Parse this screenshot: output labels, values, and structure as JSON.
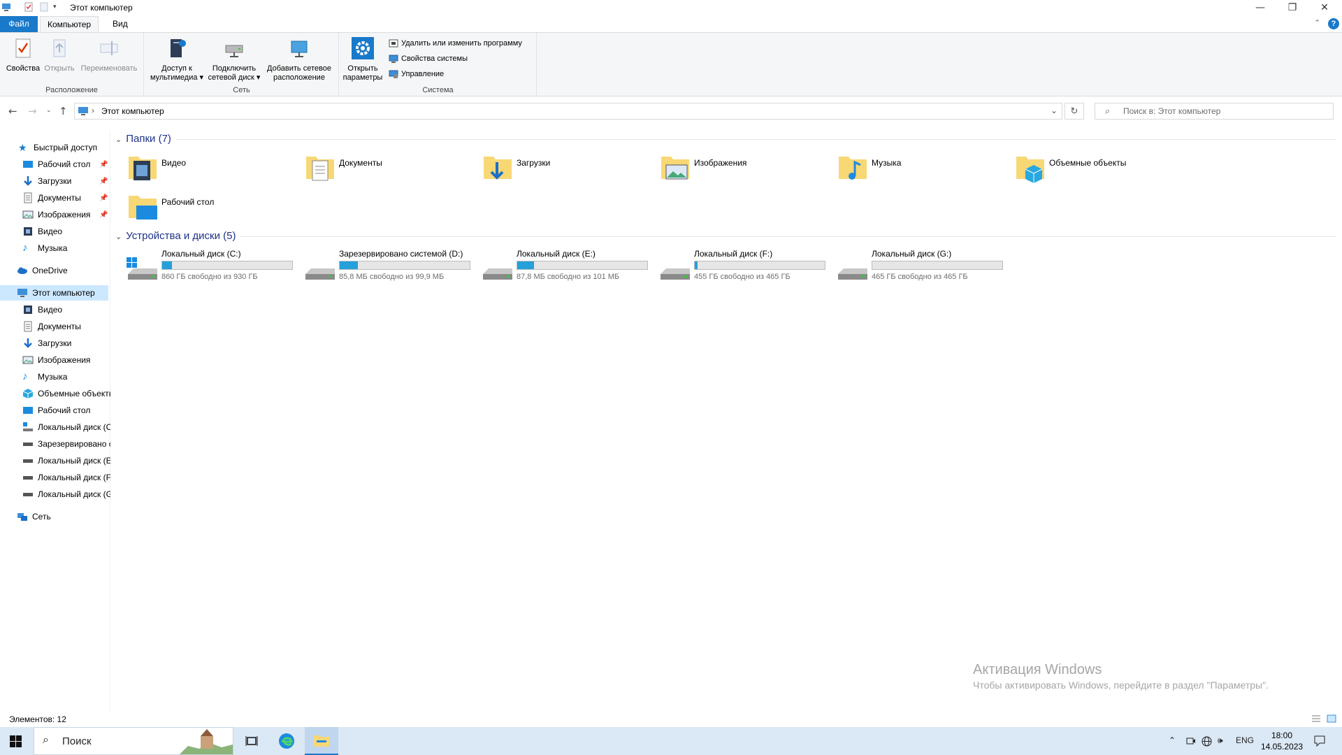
{
  "window": {
    "title": "Этот компьютер",
    "minimize": "—",
    "restore": "❐",
    "close": "✕"
  },
  "ribbon_tabs": {
    "file": "Файл",
    "computer": "Компьютер",
    "view": "Вид"
  },
  "ribbon": {
    "location": {
      "label": "Расположение",
      "properties": "Свойства",
      "open": "Открыть",
      "rename": "Переименовать"
    },
    "network": {
      "label": "Сеть",
      "media_1": "Доступ к",
      "media_2": "мультимедиа ▾",
      "map_1": "Подключить",
      "map_2": "сетевой диск ▾",
      "add_1": "Добавить сетевое",
      "add_2": "расположение"
    },
    "system": {
      "label": "Система",
      "settings_1": "Открыть",
      "settings_2": "параметры",
      "uninstall": "Удалить или изменить программу",
      "sysprops": "Свойства системы",
      "manage": "Управление"
    }
  },
  "nav": {
    "path": "Этот компьютер",
    "search_placeholder": "Поиск в: Этот компьютер"
  },
  "sidebar": {
    "quick_access": "Быстрый доступ",
    "quick_items": [
      "Рабочий стол",
      "Загрузки",
      "Документы",
      "Изображения",
      "Видео",
      "Музыка"
    ],
    "onedrive": "OneDrive",
    "this_pc": "Этот компьютер",
    "pc_items": [
      "Видео",
      "Документы",
      "Загрузки",
      "Изображения",
      "Музыка",
      "Объемные объекты",
      "Рабочий стол",
      "Локальный диск (C:)",
      "Зарезервировано системой (D:)",
      "Локальный диск (E:)",
      "Локальный диск (F:)",
      "Локальный диск (G:)"
    ],
    "network": "Сеть"
  },
  "content": {
    "folders_header": "Папки (7)",
    "folders": [
      "Видео",
      "Документы",
      "Загрузки",
      "Изображения",
      "Музыка",
      "Объемные объекты",
      "Рабочий стол"
    ],
    "drives_header": "Устройства и диски (5)",
    "drives": [
      {
        "name": "Локальный диск (C:)",
        "free": "860 ГБ свободно из 930 ГБ",
        "used_fraction": 0.075
      },
      {
        "name": "Зарезервировано системой (D:)",
        "free": "85,8 МБ свободно из 99,9 МБ",
        "used_fraction": 0.14
      },
      {
        "name": "Локальный диск (E:)",
        "free": "87,8 МБ свободно из 101 МБ",
        "used_fraction": 0.13
      },
      {
        "name": "Локальный диск (F:)",
        "free": "455 ГБ свободно из 465 ГБ",
        "used_fraction": 0.02
      },
      {
        "name": "Локальный диск (G:)",
        "free": "465 ГБ свободно из 465 ГБ",
        "used_fraction": 0.0
      }
    ]
  },
  "watermark": {
    "line1": "Активация Windows",
    "line2": "Чтобы активировать Windows, перейдите в раздел \"Параметры\"."
  },
  "status": {
    "items": "Элементов: 12"
  },
  "taskbar": {
    "search": "Поиск",
    "lang": "ENG",
    "time": "18:00",
    "date": "14.05.2023"
  },
  "colors": {
    "accent": "#1979ca",
    "selection": "#cce8ff",
    "drive_bar": "#26a0da",
    "folder_yellow": "#f8d775"
  }
}
